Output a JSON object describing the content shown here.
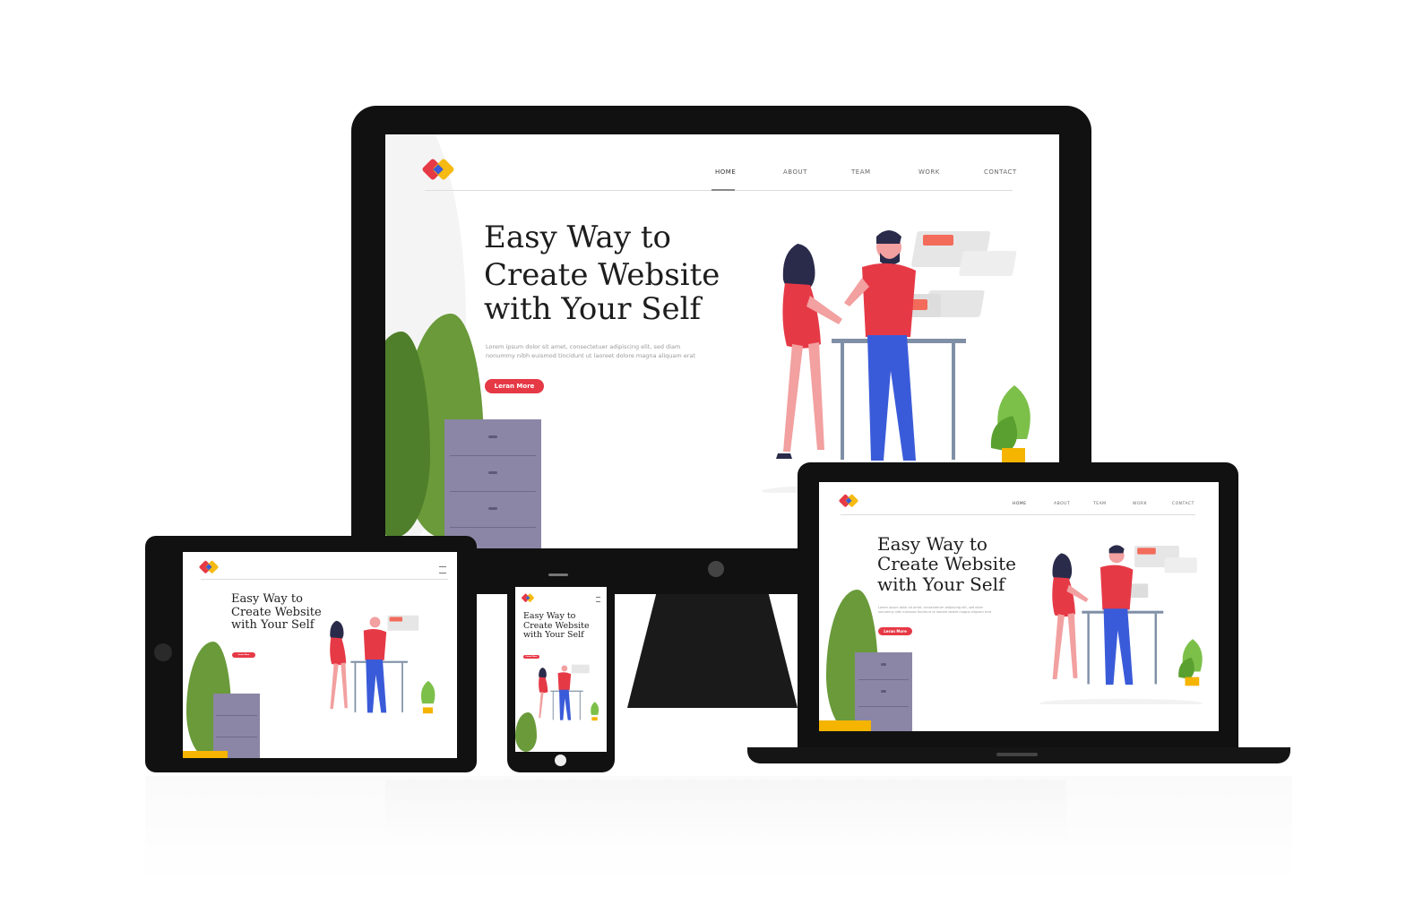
{
  "site": {
    "nav": [
      "HOME",
      "ABOUT",
      "TEAM",
      "WORK",
      "CONTACT"
    ],
    "headline": [
      "Easy Way to",
      "Create Website",
      "with Your Self"
    ],
    "lorem": [
      "Lorem ipsum dolor sit amet, consectetuer adipiscing elit, sed diam",
      "nonummy nibh euismod tincidunt ut laoreet dolore magna aliquam erat"
    ],
    "button": "Leran More"
  },
  "icons": [
    "logo-icon",
    "menu-icon"
  ],
  "colors": {
    "accent": "#e63946",
    "logo_red": "#e63946",
    "logo_yellow": "#f4b400",
    "logo_blue": "#3a5bd9",
    "plant_green": "#6a9a3a",
    "cabinet_purple": "#8b86a6",
    "device_black": "#111111"
  }
}
